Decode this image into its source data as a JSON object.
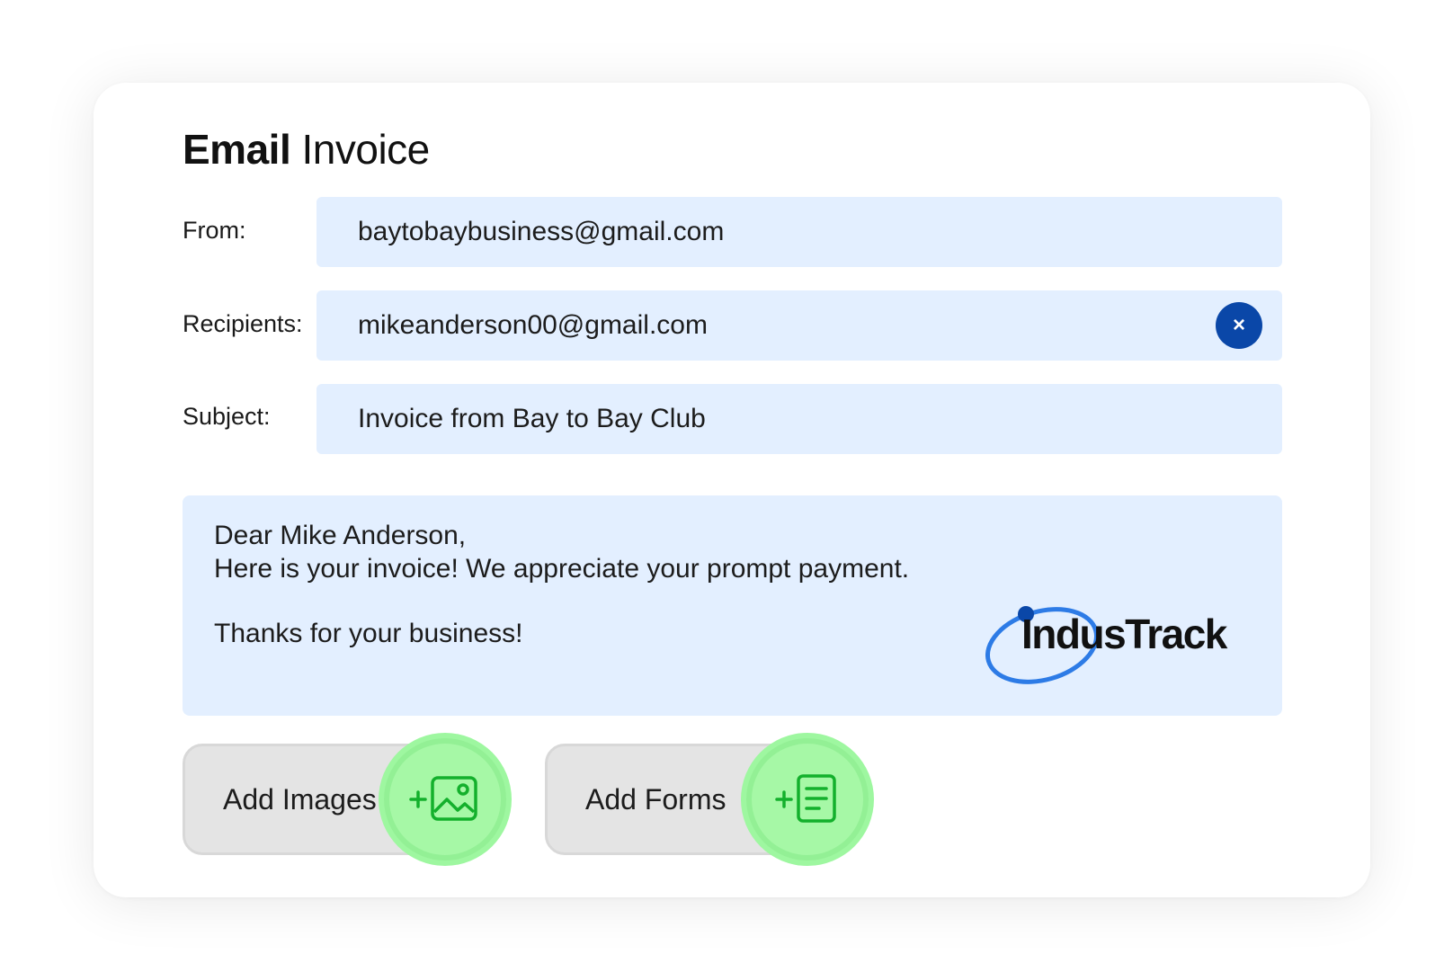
{
  "form": {
    "title_bold": "Email",
    "title_regular": "Invoice",
    "from_label": "From:",
    "from_value": "baytobaybusiness@gmail.com",
    "recipients_label": "Recipients:",
    "recipients_value": "mikeanderson00@gmail.com",
    "clear_icon": "×",
    "subject_label": "Subject:",
    "subject_value": "Invoice from Bay to Bay Club"
  },
  "message": {
    "greeting": "Dear Mike Anderson,",
    "body": "Here is your invoice! We appreciate your prompt payment.",
    "closing": "Thanks for your business!"
  },
  "logo": {
    "text": "IndusTrack",
    "ring_color": "#2d7be6",
    "dot_color": "#0a47a8"
  },
  "actions": {
    "add_images_label": "Add Images",
    "add_images_icon": "add-image-icon",
    "add_forms_label": "Add Forms",
    "add_forms_icon": "add-form-icon"
  },
  "colors": {
    "field_bg": "#e3efff",
    "clear_button": "#0a47a8",
    "action_bg": "#e4e4e4",
    "action_icon_bg": "#9ef7a0",
    "action_icon_stroke": "#13b02c"
  }
}
